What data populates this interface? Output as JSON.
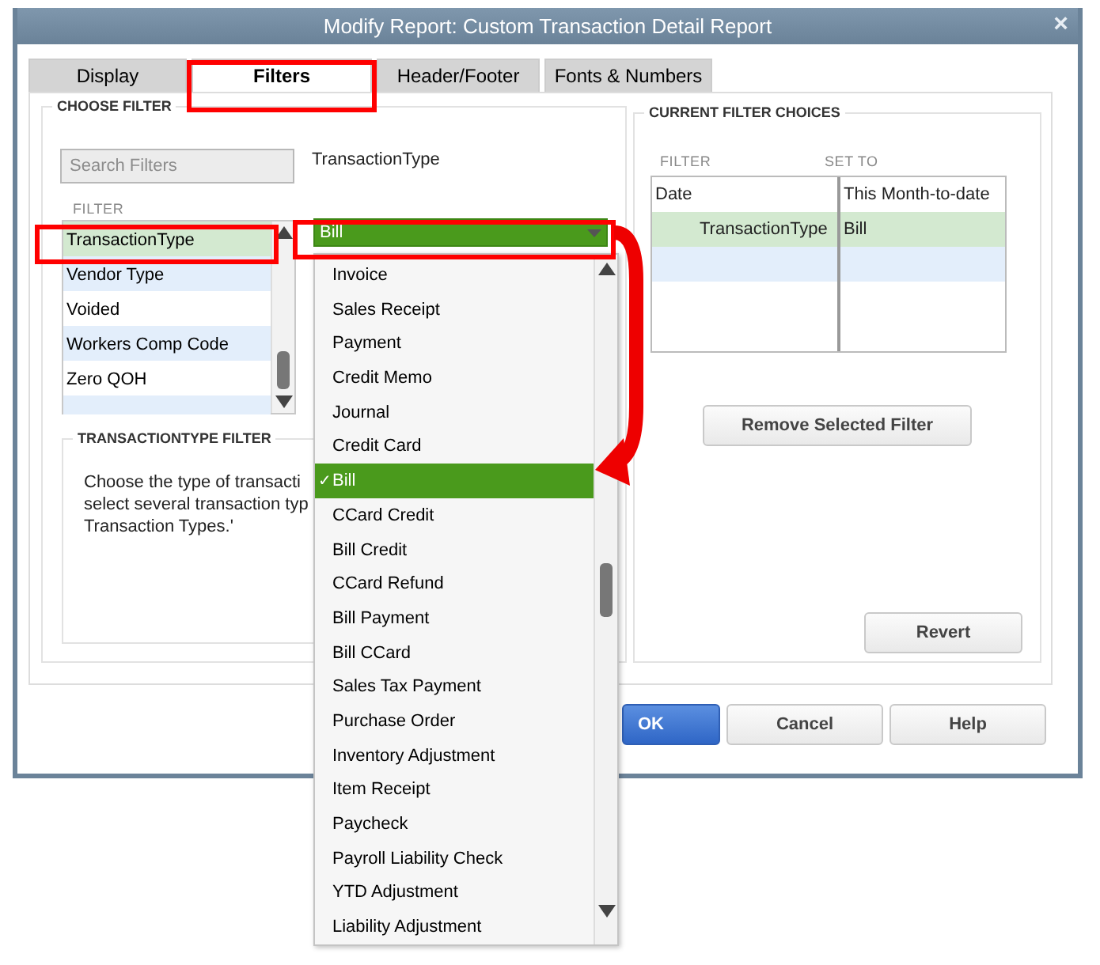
{
  "window": {
    "title": "Modify Report: Custom Transaction Detail Report",
    "close": "×"
  },
  "tabs": [
    {
      "label": "Display",
      "selected": false
    },
    {
      "label": "Filters",
      "selected": true
    },
    {
      "label": "Header/Footer",
      "selected": false
    },
    {
      "label": "Fonts & Numbers",
      "selected": false
    }
  ],
  "choose_filter": {
    "title": "CHOOSE FILTER",
    "search": {
      "placeholder": "Search Filters"
    },
    "current_filter": "TransactionType",
    "list_header": "FILTER",
    "filters": [
      {
        "label": "TransactionType",
        "selected": true
      },
      {
        "label": "Vendor Type",
        "selected": false
      },
      {
        "label": "Voided",
        "selected": false
      },
      {
        "label": "Workers Comp Code",
        "selected": false
      },
      {
        "label": "Zero QOH",
        "selected": false
      }
    ],
    "detail": {
      "title": "TRANSACTIONTYPE FILTER",
      "lines": [
        "Choose the type of transacti",
        "select several transaction typ",
        "Transaction Types.'"
      ]
    }
  },
  "dropdown": {
    "value": "Bill",
    "check": "✓",
    "options": [
      {
        "label": "Invoice",
        "selected": false
      },
      {
        "label": "Sales Receipt",
        "selected": false
      },
      {
        "label": "Payment",
        "selected": false
      },
      {
        "label": "Credit Memo",
        "selected": false
      },
      {
        "label": "Journal",
        "selected": false
      },
      {
        "label": "Credit Card",
        "selected": false
      },
      {
        "label": "Bill",
        "selected": true
      },
      {
        "label": "CCard Credit",
        "selected": false
      },
      {
        "label": "Bill Credit",
        "selected": false
      },
      {
        "label": "CCard Refund",
        "selected": false
      },
      {
        "label": "Bill Payment",
        "selected": false
      },
      {
        "label": "Bill CCard",
        "selected": false
      },
      {
        "label": "Sales Tax Payment",
        "selected": false
      },
      {
        "label": "Purchase Order",
        "selected": false
      },
      {
        "label": "Inventory Adjustment",
        "selected": false
      },
      {
        "label": "Item Receipt",
        "selected": false
      },
      {
        "label": "Paycheck",
        "selected": false
      },
      {
        "label": "Payroll Liability Check",
        "selected": false
      },
      {
        "label": "YTD Adjustment",
        "selected": false
      },
      {
        "label": "Liability Adjustment",
        "selected": false
      }
    ]
  },
  "current_filter_choices": {
    "title": "CURRENT FILTER CHOICES",
    "columns": [
      "FILTER",
      "SET TO"
    ],
    "rows": [
      {
        "filter": "Date",
        "set_to": "This Month-to-date",
        "selected": false
      },
      {
        "filter": "TransactionType",
        "set_to": "Bill",
        "selected": true
      }
    ],
    "remove_button": {
      "label": "Remove Selected Filter"
    }
  },
  "revert_button": {
    "label": "Revert"
  },
  "buttons": [
    {
      "label": "OK",
      "kind": "primary"
    },
    {
      "label": "Cancel",
      "kind": "default"
    },
    {
      "label": "Help",
      "kind": "default"
    }
  ]
}
